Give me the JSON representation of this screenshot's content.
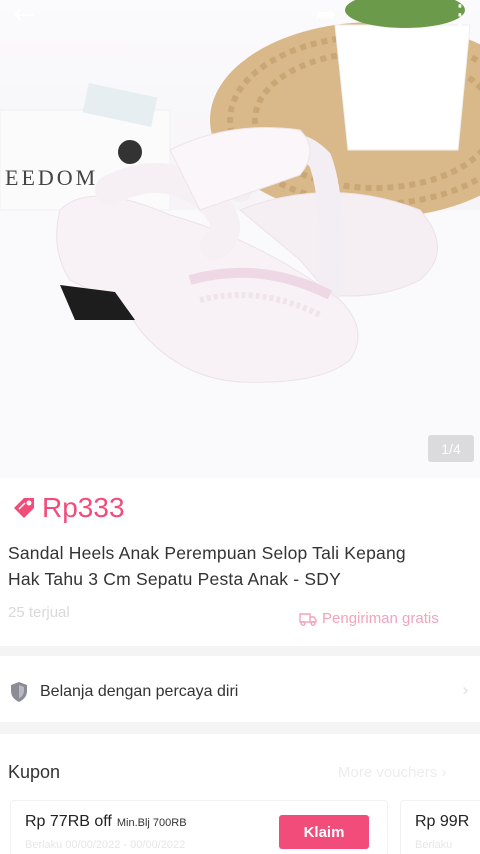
{
  "product": {
    "image_counter": "1/4",
    "price": "Rp333",
    "title_line1": "Sandal Heels Anak Perempuan Selop Tali Kepang",
    "title_line2": "Hak Tahu 3 Cm Sepatu Pesta Anak - SDY",
    "sold": "25 terjual",
    "shipping": "Pengiriman gratis"
  },
  "trust": {
    "label": "Belanja dengan percaya diri"
  },
  "coupons": {
    "header": "Kupon",
    "more_label": "More vouchers",
    "items": [
      {
        "amount": "Rp 77RB off",
        "min": "Min.Blj 700RB",
        "date": "Berlaku 00/00/2022 - 00/00/2022",
        "claim_label": "Klaim"
      },
      {
        "amount": "Rp 99R",
        "date": "Berlaku"
      }
    ]
  },
  "colors": {
    "accent": "#f24c7b",
    "accent_light": "#f4a3bb"
  },
  "icons": {
    "back": "back-arrow-icon",
    "share": "share-icon",
    "more": "more-dots-icon",
    "price_tag": "price-tag-icon",
    "shipping": "truck-icon",
    "shield": "shield-icon"
  }
}
